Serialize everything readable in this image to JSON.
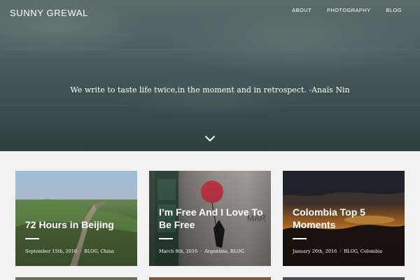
{
  "site": {
    "title": "SUNNY GREWAL"
  },
  "nav": {
    "items": [
      "ABOUT",
      "PHOTOGRAPHY",
      "BLOG"
    ]
  },
  "hero": {
    "quote": "We write to taste life twice,in the moment and in retrospect. -Anaïs Nin"
  },
  "posts": [
    {
      "title": "72 Hours in Beijing",
      "date": "September 15th, 2016",
      "categories": "BLOG, China"
    },
    {
      "title": "I’m Free And I Love To Be Free",
      "date": "March 8th, 2016",
      "categories": "Argentina, BLOG"
    },
    {
      "title": "Colombia Top 5 Moments",
      "date": "January 26th, 2016",
      "categories": "BLOG, Colombia"
    }
  ],
  "colors": {
    "hero": "#4d605f",
    "page_bg": "#f2f2f2",
    "text": "#ffffff"
  },
  "icons": {
    "scroll": "chevron-down-icon"
  }
}
